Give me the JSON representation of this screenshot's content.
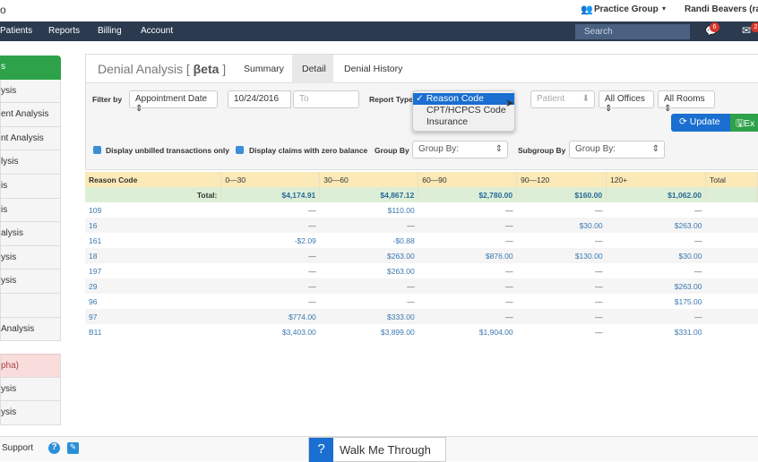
{
  "topbar": {
    "logo_fragment": "o",
    "practice_group": "Practice Group",
    "user": "Randi Beavers (ra"
  },
  "nav": {
    "items": [
      "Patients",
      "Reports",
      "Billing",
      "Account"
    ],
    "search_placeholder": "Search",
    "notifications_count": "6",
    "messages_count": "2"
  },
  "sidebar": {
    "items": [
      {
        "label": "s",
        "state": "active"
      },
      {
        "label": "ysis"
      },
      {
        "label": "ent Analysis"
      },
      {
        "label": "nt Analysis"
      },
      {
        "label": "lysis"
      },
      {
        "label": "is"
      },
      {
        "label": "is"
      },
      {
        "label": "alysis"
      },
      {
        "label": "ysis"
      },
      {
        "label": "ysis"
      },
      {
        "label": ""
      },
      {
        "label": "Analysis"
      }
    ],
    "items2": [
      {
        "label": "pha)",
        "state": "alpha"
      },
      {
        "label": "ysis"
      },
      {
        "label": "ysis"
      }
    ]
  },
  "page": {
    "title": "Denial Analysis [",
    "title_beta": "βeta",
    "title_close": "]",
    "tabs": [
      "Summary",
      "Detail",
      "Denial History"
    ],
    "active_tab": "Detail"
  },
  "filters": {
    "filter_by_label": "Filter by",
    "filter_by_value": "Appointment Date",
    "from_date": "10/24/2016",
    "to_placeholder": "To",
    "report_type_label": "Report Type",
    "report_type_options": [
      "Reason Code",
      "CPT/HCPCS Code",
      "Insurance"
    ],
    "report_type_selected": "Reason Code",
    "patient_placeholder": "Patient",
    "offices": "All Offices",
    "rooms": "All Rooms",
    "update_label": "Update",
    "export_label": "Ex",
    "unbilled_label": "Display unbilled transactions only",
    "zero_balance_label": "Display claims with zero balance",
    "group_by_label": "Group By",
    "group_by_value": "Group By:",
    "subgroup_by_label": "Subgroup By",
    "subgroup_by_value": "Group By:"
  },
  "table": {
    "headers": [
      "Reason Code",
      "0—30",
      "30—60",
      "60—90",
      "90—120",
      "120+",
      "Total"
    ],
    "total_row": [
      "Total:",
      "$4,174.91",
      "$4,867.12",
      "$2,780.00",
      "$160.00",
      "$1,062.00",
      ""
    ],
    "rows": [
      [
        "109",
        "—",
        "$110.00",
        "—",
        "—",
        "—",
        ""
      ],
      [
        "16",
        "—",
        "—",
        "—",
        "$30.00",
        "$263.00",
        ""
      ],
      [
        "161",
        "-$2.09",
        "-$0.88",
        "—",
        "—",
        "—",
        ""
      ],
      [
        "18",
        "—",
        "$263.00",
        "$876.00",
        "$130.00",
        "$30.00",
        ""
      ],
      [
        "197",
        "—",
        "$263.00",
        "—",
        "—",
        "—",
        ""
      ],
      [
        "29",
        "—",
        "—",
        "—",
        "—",
        "$263.00",
        ""
      ],
      [
        "96",
        "—",
        "—",
        "—",
        "—",
        "$175.00",
        ""
      ],
      [
        "97",
        "$774.00",
        "$333.00",
        "—",
        "—",
        "—",
        ""
      ],
      [
        "B11",
        "$3,403.00",
        "$3,899.00",
        "$1,904.00",
        "—",
        "$331.00",
        ""
      ]
    ]
  },
  "footer": {
    "support": "Support",
    "walk_me": "Walk Me Through",
    "walk_me_icon": "?"
  },
  "colors": {
    "nav": "#2b3a4f",
    "active": "#2ea24a",
    "update": "#1a6fd0",
    "export": "#2ea24a",
    "header_row": "#fbe9b7",
    "total_row": "#dcefd6"
  }
}
